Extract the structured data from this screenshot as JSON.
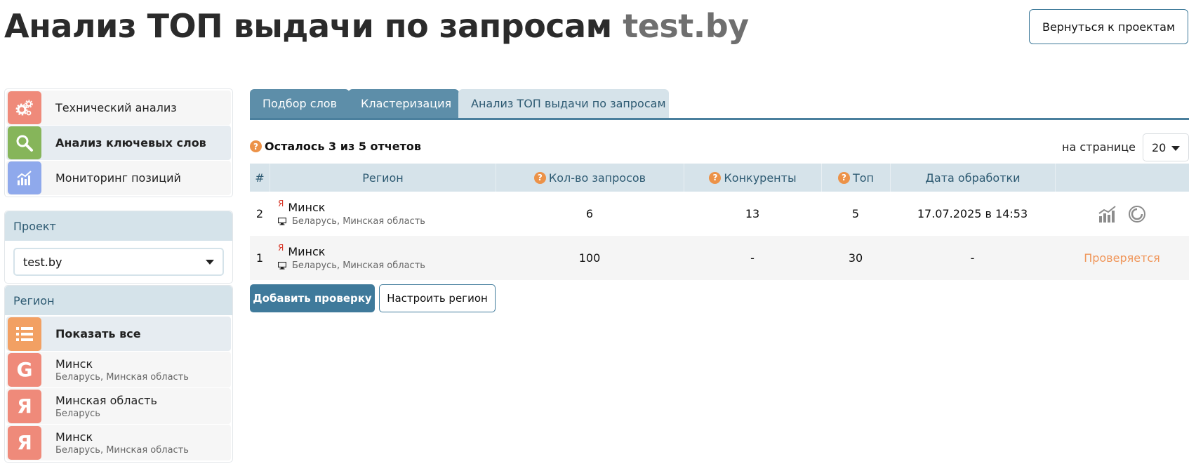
{
  "header": {
    "title": "Анализ ТОП выдачи по запросам",
    "domain": "test.by",
    "back_button": "Вернуться к проектам"
  },
  "sidebar": {
    "menu": [
      {
        "label": "Технический анализ",
        "icon": "gears-icon",
        "color": "#ef8a7a"
      },
      {
        "label": "Анализ ключевых слов",
        "icon": "search-icon",
        "color": "#86b55a"
      },
      {
        "label": "Мониторинг позиций",
        "icon": "chart-icon",
        "color": "#8fa9ec"
      }
    ],
    "project": {
      "heading": "Проект",
      "selected": "test.by"
    },
    "region": {
      "heading": "Регион",
      "items": [
        {
          "name": "Показать все",
          "sub": "",
          "icon": "list-icon"
        },
        {
          "name": "Минск",
          "sub": "Беларусь, Минская область",
          "icon": "google-icon",
          "glyph": "G"
        },
        {
          "name": "Минская область",
          "sub": "Беларусь",
          "icon": "yandex-icon",
          "glyph": "Я"
        },
        {
          "name": "Минск",
          "sub": "Беларусь, Минская область",
          "icon": "yandex-icon",
          "glyph": "Я"
        }
      ]
    }
  },
  "tabs": [
    {
      "label": "Подбор слов"
    },
    {
      "label": "Кластеризация"
    },
    {
      "label": "Анализ ТОП выдачи по запросам",
      "active": true
    }
  ],
  "info": {
    "remaining": "Осталось 3 из 5 отчетов",
    "per_page_label": "на странице",
    "per_page_value": "20"
  },
  "table": {
    "headers": {
      "num": "#",
      "region": "Регион",
      "queries": "Кол-во запросов",
      "competitors": "Конкуренты",
      "top": "Топ",
      "date": "Дата обработки"
    },
    "rows": [
      {
        "num": "2",
        "engine_glyph": "Я",
        "region": "Минск",
        "sub": "Беларусь, Минская область",
        "queries": "6",
        "competitors": "13",
        "top": "5",
        "date": "17.07.2025 в 14:53",
        "status": ""
      },
      {
        "num": "1",
        "engine_glyph": "Я",
        "region": "Минск",
        "sub": "Беларусь, Минская область",
        "queries": "100",
        "competitors": "-",
        "top": "30",
        "date": "-",
        "status": "Проверяется"
      }
    ]
  },
  "buttons": {
    "add_check": "Добавить проверку",
    "configure_region": "Настроить регион"
  },
  "colors": {
    "accent": "#3f7a9b",
    "tab_active_bg": "#d6e3ea",
    "status_checking": "#f0965a",
    "help_icon": "#ec9248"
  }
}
